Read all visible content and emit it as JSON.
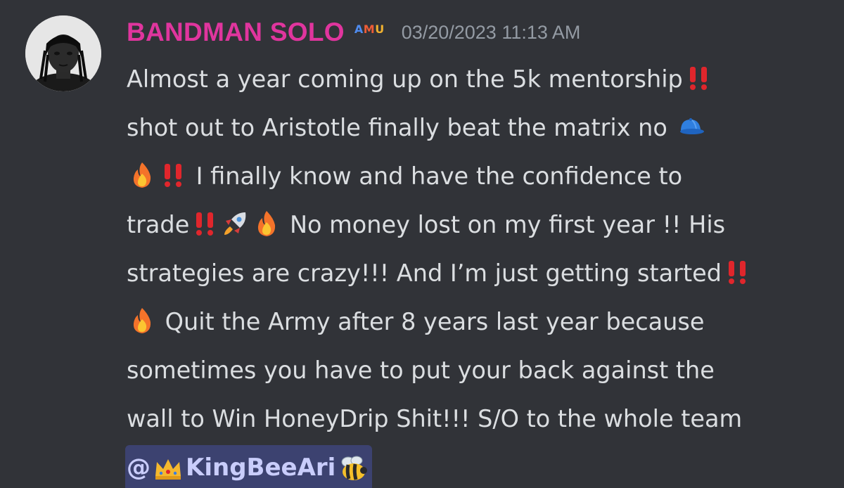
{
  "author": {
    "name": "BANDMAN SOLO",
    "role_tag": [
      "A",
      "M",
      "U"
    ],
    "name_color": "#e0359e",
    "avatar_icon": "avatar-portrait"
  },
  "timestamp": "03/20/2023 11:13 AM",
  "message": {
    "lines": [
      "Almost a year coming up on the 5k mentorship",
      "shot out to Aristotle finally beat the matrix no",
      " I finally know and have the confidence to",
      "trade",
      " No money lost on my first year !! His",
      "strategies are crazy!!! And I’m just getting started",
      " Quit the Army after 8 years last year because",
      "sometimes you have to put your back against the",
      "wall to Win HoneyDrip Shit!!! S/O to the whole team"
    ],
    "mention": {
      "prefix": "@",
      "name": "KingBeeAri",
      "icons": [
        "crown-icon",
        "bee-icon"
      ]
    },
    "emoji_names": [
      "double-exclamation-icon",
      "cap-icon",
      "fire-icon",
      "rocket-icon"
    ]
  },
  "colors": {
    "background": "#313338",
    "text": "#dbdee1",
    "timestamp": "#949ba4",
    "mention_bg": "#3c4270",
    "mention_text": "#c9cdfb"
  }
}
